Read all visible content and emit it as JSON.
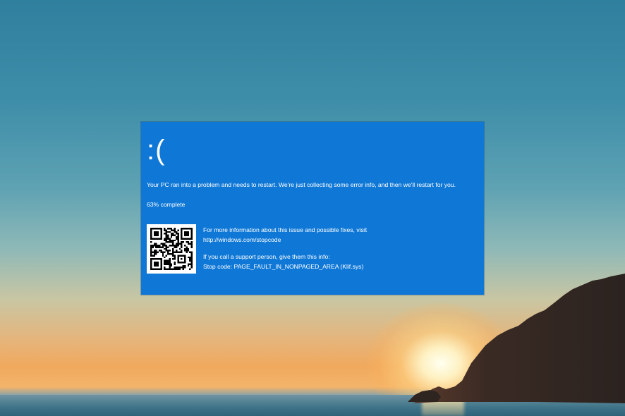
{
  "colors": {
    "bsod_background": "#0f78d7",
    "text": "#ffffff"
  },
  "bsod": {
    "sad_face": ":(",
    "message": "Your PC ran into a problem and needs to restart. We're just collecting some error info, and then we'll restart for you.",
    "progress_percent": 63,
    "progress_text": "63% complete",
    "more_info": "For more information about this issue and possible fixes, visit",
    "stopcode_url": "http://windows.com/stopcode",
    "support_prompt": "If you call a support person, give them this info:",
    "stop_code": "Stop code: PAGE_FAULT_IN_NONPAGED_AREA (Klif.sys)"
  },
  "icons": {
    "qr_code": "qr-code-icon"
  }
}
